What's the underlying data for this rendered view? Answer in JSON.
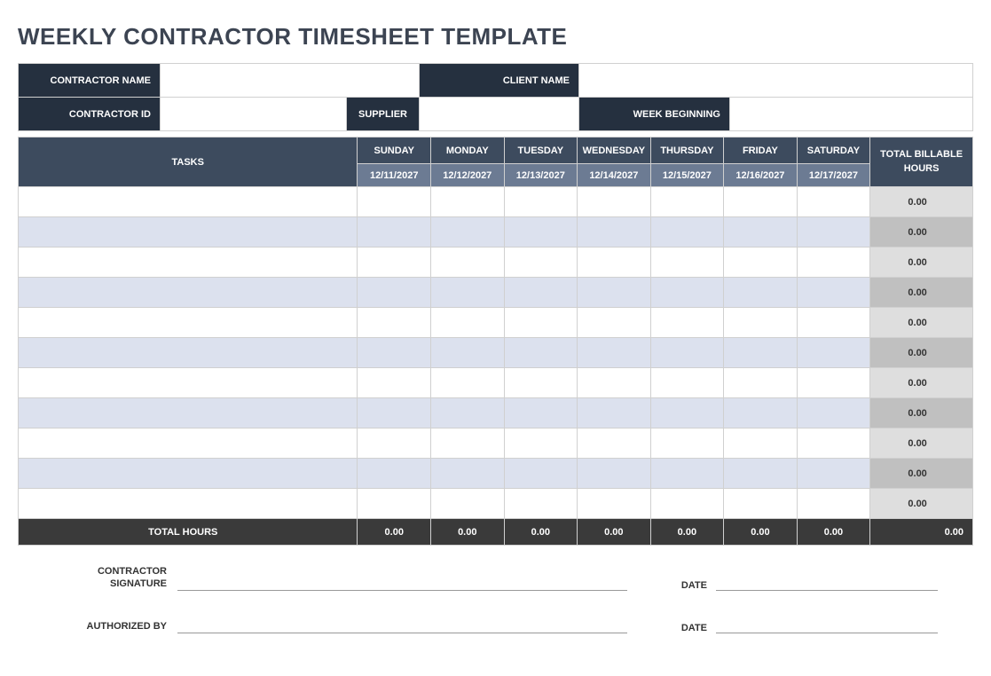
{
  "title": "WEEKLY CONTRACTOR TIMESHEET TEMPLATE",
  "info": {
    "contractor_name_label": "CONTRACTOR NAME",
    "contractor_name_value": "",
    "client_name_label": "CLIENT NAME",
    "client_name_value": "",
    "contractor_id_label": "CONTRACTOR ID",
    "contractor_id_value": "",
    "supplier_label": "SUPPLIER",
    "supplier_value": "",
    "week_beginning_label": "WEEK BEGINNING",
    "week_beginning_value": ""
  },
  "headers": {
    "tasks": "TASKS",
    "days": [
      "SUNDAY",
      "MONDAY",
      "TUESDAY",
      "WEDNESDAY",
      "THURSDAY",
      "FRIDAY",
      "SATURDAY"
    ],
    "dates": [
      "12/11/2027",
      "12/12/2027",
      "12/13/2027",
      "12/14/2027",
      "12/15/2027",
      "12/16/2027",
      "12/17/2027"
    ],
    "billable": "TOTAL BILLABLE HOURS"
  },
  "rows": [
    {
      "task": "",
      "days": [
        "",
        "",
        "",
        "",
        "",
        "",
        ""
      ],
      "billable": "0.00"
    },
    {
      "task": "",
      "days": [
        "",
        "",
        "",
        "",
        "",
        "",
        ""
      ],
      "billable": "0.00"
    },
    {
      "task": "",
      "days": [
        "",
        "",
        "",
        "",
        "",
        "",
        ""
      ],
      "billable": "0.00"
    },
    {
      "task": "",
      "days": [
        "",
        "",
        "",
        "",
        "",
        "",
        ""
      ],
      "billable": "0.00"
    },
    {
      "task": "",
      "days": [
        "",
        "",
        "",
        "",
        "",
        "",
        ""
      ],
      "billable": "0.00"
    },
    {
      "task": "",
      "days": [
        "",
        "",
        "",
        "",
        "",
        "",
        ""
      ],
      "billable": "0.00"
    },
    {
      "task": "",
      "days": [
        "",
        "",
        "",
        "",
        "",
        "",
        ""
      ],
      "billable": "0.00"
    },
    {
      "task": "",
      "days": [
        "",
        "",
        "",
        "",
        "",
        "",
        ""
      ],
      "billable": "0.00"
    },
    {
      "task": "",
      "days": [
        "",
        "",
        "",
        "",
        "",
        "",
        ""
      ],
      "billable": "0.00"
    },
    {
      "task": "",
      "days": [
        "",
        "",
        "",
        "",
        "",
        "",
        ""
      ],
      "billable": "0.00"
    },
    {
      "task": "",
      "days": [
        "",
        "",
        "",
        "",
        "",
        "",
        ""
      ],
      "billable": "0.00"
    }
  ],
  "totals": {
    "label": "TOTAL HOURS",
    "days": [
      "0.00",
      "0.00",
      "0.00",
      "0.00",
      "0.00",
      "0.00",
      "0.00"
    ],
    "billable": "0.00"
  },
  "signatures": {
    "contractor_signature_label": "CONTRACTOR SIGNATURE",
    "authorized_by_label": "AUTHORIZED BY",
    "date_label": "DATE"
  }
}
